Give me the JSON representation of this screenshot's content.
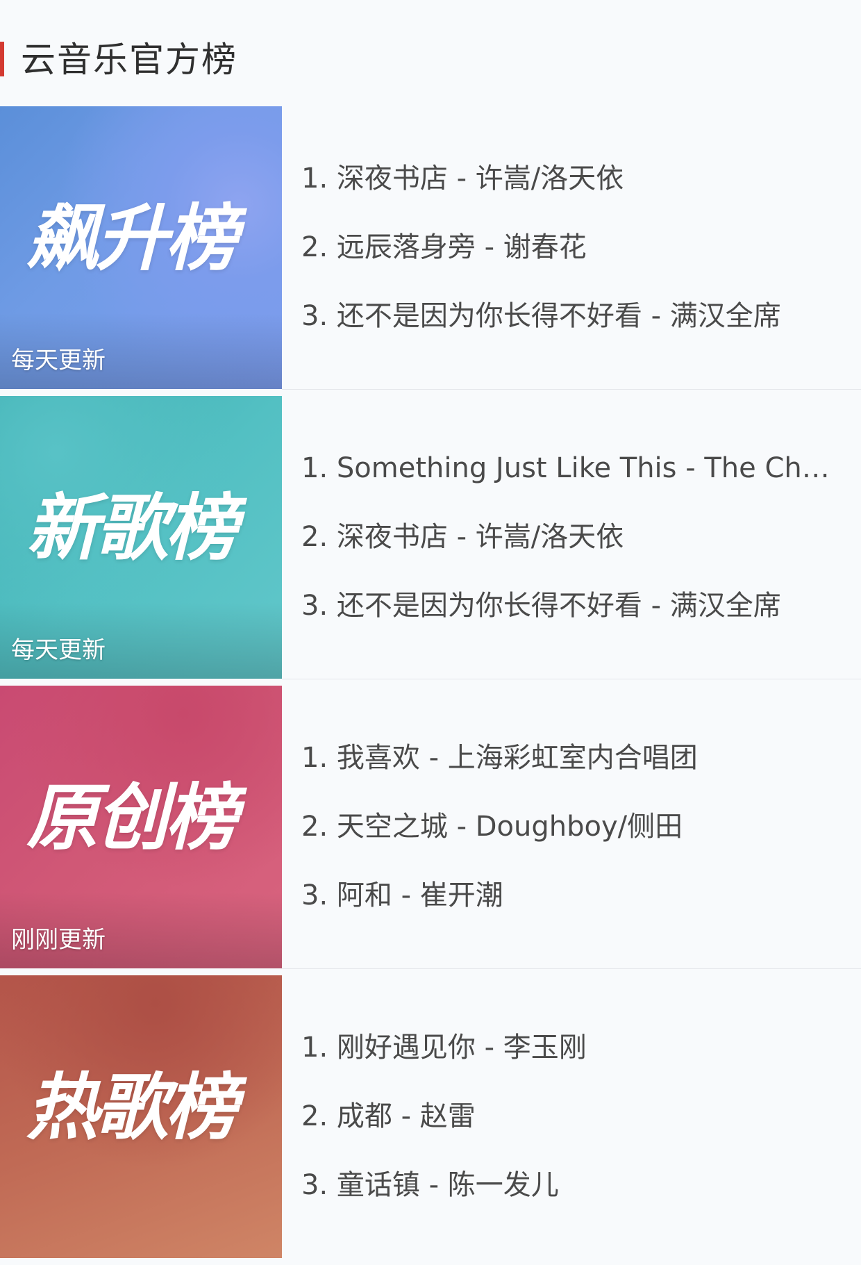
{
  "section": {
    "title": "云音乐官方榜",
    "accent_color": "#d33a31"
  },
  "ranks": [
    {
      "cover_title": "飙升榜",
      "update_note": "每天更新",
      "gradient": [
        "#6c9be2",
        "#7b9ef0"
      ],
      "tracks": [
        "1. 深夜书店 - 许嵩/洛天依",
        "2. 远辰落身旁 - 谢春花",
        "3. 还不是因为你长得不好看 - 满汉全席"
      ]
    },
    {
      "cover_title": "新歌榜",
      "update_note": "每天更新",
      "gradient": [
        "#4fbdc0",
        "#5fc5c8"
      ],
      "tracks": [
        "1. Something Just Like This - The Cha...",
        "2. 深夜书店 - 许嵩/洛天依",
        "3. 还不是因为你长得不好看 - 满汉全席"
      ]
    },
    {
      "cover_title": "原创榜",
      "update_note": "刚刚更新",
      "gradient": [
        "#c94a72",
        "#d65d80"
      ],
      "tracks": [
        "1. 我喜欢 - 上海彩虹室内合唱团",
        "2. 天空之城 - Doughboy/侧田",
        "3. 阿和 - 崔开潮"
      ]
    },
    {
      "cover_title": "热歌榜",
      "update_note": "",
      "gradient": [
        "#b4554a",
        "#cf8566"
      ],
      "tracks": [
        "1. 刚好遇见你 - 李玉刚",
        "2. 成都 - 赵雷",
        "3. 童话镇 - 陈一发儿"
      ]
    }
  ]
}
